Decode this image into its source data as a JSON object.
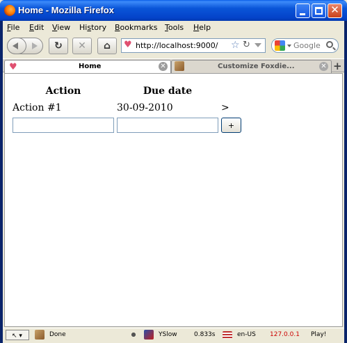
{
  "window": {
    "title": "Home - Mozilla Firefox",
    "controls": {
      "minimize": "",
      "maximize": "",
      "close": "✕"
    }
  },
  "menubar": {
    "items": [
      {
        "key": "F",
        "rest": "ile"
      },
      {
        "key": "E",
        "rest": "dit"
      },
      {
        "key": "V",
        "rest": "iew"
      },
      {
        "key": "",
        "pre": "Hi",
        "u": "s",
        "post": "tory"
      },
      {
        "key": "B",
        "rest": "ookmarks"
      },
      {
        "key": "T",
        "rest": "ools"
      },
      {
        "key": "H",
        "rest": "elp"
      }
    ]
  },
  "navbar": {
    "url": "http://localhost:9000/",
    "search_placeholder": "Google",
    "reload_glyph": "↻",
    "stop_glyph": "✕",
    "home_glyph": "⌂",
    "star_glyph": "☆",
    "url_reload_glyph": "↻"
  },
  "tabs": [
    {
      "label": "Home",
      "active": true,
      "close": "✕"
    },
    {
      "label": "Customize Foxdie...",
      "active": false,
      "close": "✕"
    }
  ],
  "newtab_glyph": "+",
  "table": {
    "headers": [
      "Action",
      "Due date",
      ""
    ],
    "rows": [
      {
        "action": "Action #1",
        "due": "30-09-2010",
        "link": ">"
      }
    ],
    "new_action_value": "",
    "new_due_value": "",
    "add_button_label": "+"
  },
  "statusbar": {
    "status": "Done",
    "yslow": "YSlow",
    "load_time": "0.833s",
    "locale": "en-US",
    "ip": "127.0.0.1",
    "play": "Play!"
  },
  "colors": {
    "titlebar": "#0a55d8",
    "ip_text": "#cc0000",
    "favicon": "#e05070"
  }
}
